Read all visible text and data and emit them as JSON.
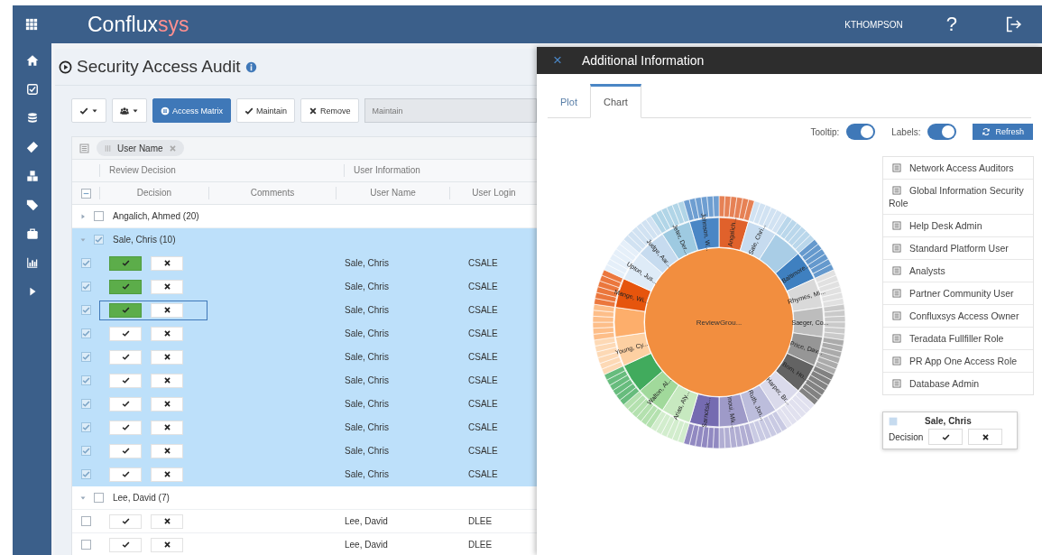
{
  "header": {
    "logo_main": "Conflux",
    "logo_accent": "sys",
    "user": "KTHOMPSON",
    "help": "?"
  },
  "sidebar": {
    "items": [
      {
        "kind": "home"
      },
      {
        "kind": "check"
      },
      {
        "kind": "database"
      },
      {
        "kind": "ticket"
      },
      {
        "kind": "cubes"
      },
      {
        "kind": "tag"
      },
      {
        "kind": "briefcase"
      },
      {
        "kind": "chart"
      },
      {
        "kind": "expand"
      }
    ]
  },
  "page": {
    "title": "Security Access Audit"
  },
  "toolbar": {
    "buttons": [
      {
        "kind": "check-dropdown"
      },
      {
        "kind": "users-dropdown"
      },
      {
        "kind": "primary",
        "label": "Access Matrix"
      },
      {
        "kind": "maintain",
        "label": "Maintain"
      },
      {
        "kind": "remove",
        "label": "Remove"
      }
    ],
    "field": {
      "value": "Maintain"
    }
  },
  "grid": {
    "group_by": {
      "label": "User Name"
    },
    "column_groups": [
      {
        "label": "Review Decision"
      },
      {
        "label": "User Information"
      }
    ],
    "select_all": {
      "indeterminate": true
    },
    "columns": [
      "Decision",
      "Comments",
      "User Name",
      "User Login"
    ],
    "groups": [
      {
        "label": "Angalich, Ahmed (20)",
        "expanded": false,
        "checked": false
      },
      {
        "label": "Sale, Chris (10)",
        "expanded": true,
        "checked": true,
        "rows": [
          {
            "checked": true,
            "approved": true,
            "focused": false,
            "user_name": "Sale, Chris",
            "user_login": "CSALE"
          },
          {
            "checked": true,
            "approved": true,
            "focused": false,
            "user_name": "Sale, Chris",
            "user_login": "CSALE"
          },
          {
            "checked": true,
            "approved": true,
            "focused": true,
            "user_name": "Sale, Chris",
            "user_login": "CSALE"
          },
          {
            "checked": true,
            "approved": false,
            "focused": false,
            "user_name": "Sale, Chris",
            "user_login": "CSALE"
          },
          {
            "checked": true,
            "approved": false,
            "focused": false,
            "user_name": "Sale, Chris",
            "user_login": "CSALE"
          },
          {
            "checked": true,
            "approved": false,
            "focused": false,
            "user_name": "Sale, Chris",
            "user_login": "CSALE"
          },
          {
            "checked": true,
            "approved": false,
            "focused": false,
            "user_name": "Sale, Chris",
            "user_login": "CSALE"
          },
          {
            "checked": true,
            "approved": false,
            "focused": false,
            "user_name": "Sale, Chris",
            "user_login": "CSALE"
          },
          {
            "checked": true,
            "approved": false,
            "focused": false,
            "user_name": "Sale, Chris",
            "user_login": "CSALE"
          },
          {
            "checked": true,
            "approved": false,
            "focused": false,
            "user_name": "Sale, Chris",
            "user_login": "CSALE"
          }
        ]
      },
      {
        "label": "Lee, David (7)",
        "expanded": true,
        "checked": false,
        "rows": [
          {
            "checked": false,
            "approved": false,
            "focused": false,
            "user_name": "Lee, David",
            "user_login": "DLEE"
          },
          {
            "checked": false,
            "approved": false,
            "focused": false,
            "user_name": "Lee, David",
            "user_login": "DLEE"
          }
        ]
      }
    ]
  },
  "panel": {
    "close": "×",
    "title": "Additional Information",
    "tabs": [
      {
        "label": "Plot",
        "selected": false
      },
      {
        "label": "Chart",
        "selected": true
      }
    ],
    "toggles": [
      {
        "label": "Tooltip:",
        "on": true
      },
      {
        "label": "Labels:",
        "on": true
      }
    ],
    "refresh": "Refresh",
    "sunburst": {
      "center_label": "ReviewGrou...",
      "segments": [
        {
          "label": "Angalich...",
          "color": "#e0612b"
        },
        {
          "label": "Sale, Chri...",
          "color": "#c6dbef"
        },
        {
          "color": "#a9cde6"
        },
        {
          "label": "Baltimore...",
          "color": "#3f80c0"
        },
        {
          "label": "Rhymes, Mi...",
          "color": "#d9d9d9"
        },
        {
          "label": "Saeger, Co...",
          "color": "#bdbdbd"
        },
        {
          "label": "Price, Dav...",
          "color": "#969696"
        },
        {
          "label": "Bom, Ho...",
          "color": "#636363"
        },
        {
          "label": "Harper, Br...",
          "color": "#dadaeb"
        },
        {
          "label": "Ruth, Jon...",
          "color": "#bcbddc"
        },
        {
          "label": "Inoui, Mik...",
          "color": "#9e9ac8"
        },
        {
          "label": "Sarnotsk...",
          "color": "#756bb1"
        },
        {
          "label": "Arias, Aly...",
          "color": "#c7e9c0"
        },
        {
          "label": "Walton, Al...",
          "color": "#a1d99b"
        },
        {
          "color": "#41ab5d"
        },
        {
          "label": "Young, Cy...",
          "color": "#fdd0a2"
        },
        {
          "color": "#fdae6b"
        },
        {
          "label": "Mange, Wi...",
          "color": "#e6550d"
        },
        {
          "label": "Upton, Jus...",
          "color": "#deebf7"
        },
        {
          "label": "Judge, Aar...",
          "color": "#c6dbef"
        },
        {
          "label": "Jeter, Der...",
          "color": "#9ecae1"
        },
        {
          "label": "Johnson, W...",
          "color": "#4a86c5"
        }
      ]
    },
    "legend": [
      "Network Access Auditors",
      "Global Information Security Role",
      "Help Desk Admin",
      "Standard Platform User",
      "Analysts",
      "Partner Community User",
      "Confluxsys Access Owner",
      "Teradata Fullfiller Role",
      "PR App One Access Role",
      "Database Admin"
    ],
    "tooltip": {
      "title": "Sale, Chris",
      "label": "Decision"
    }
  }
}
